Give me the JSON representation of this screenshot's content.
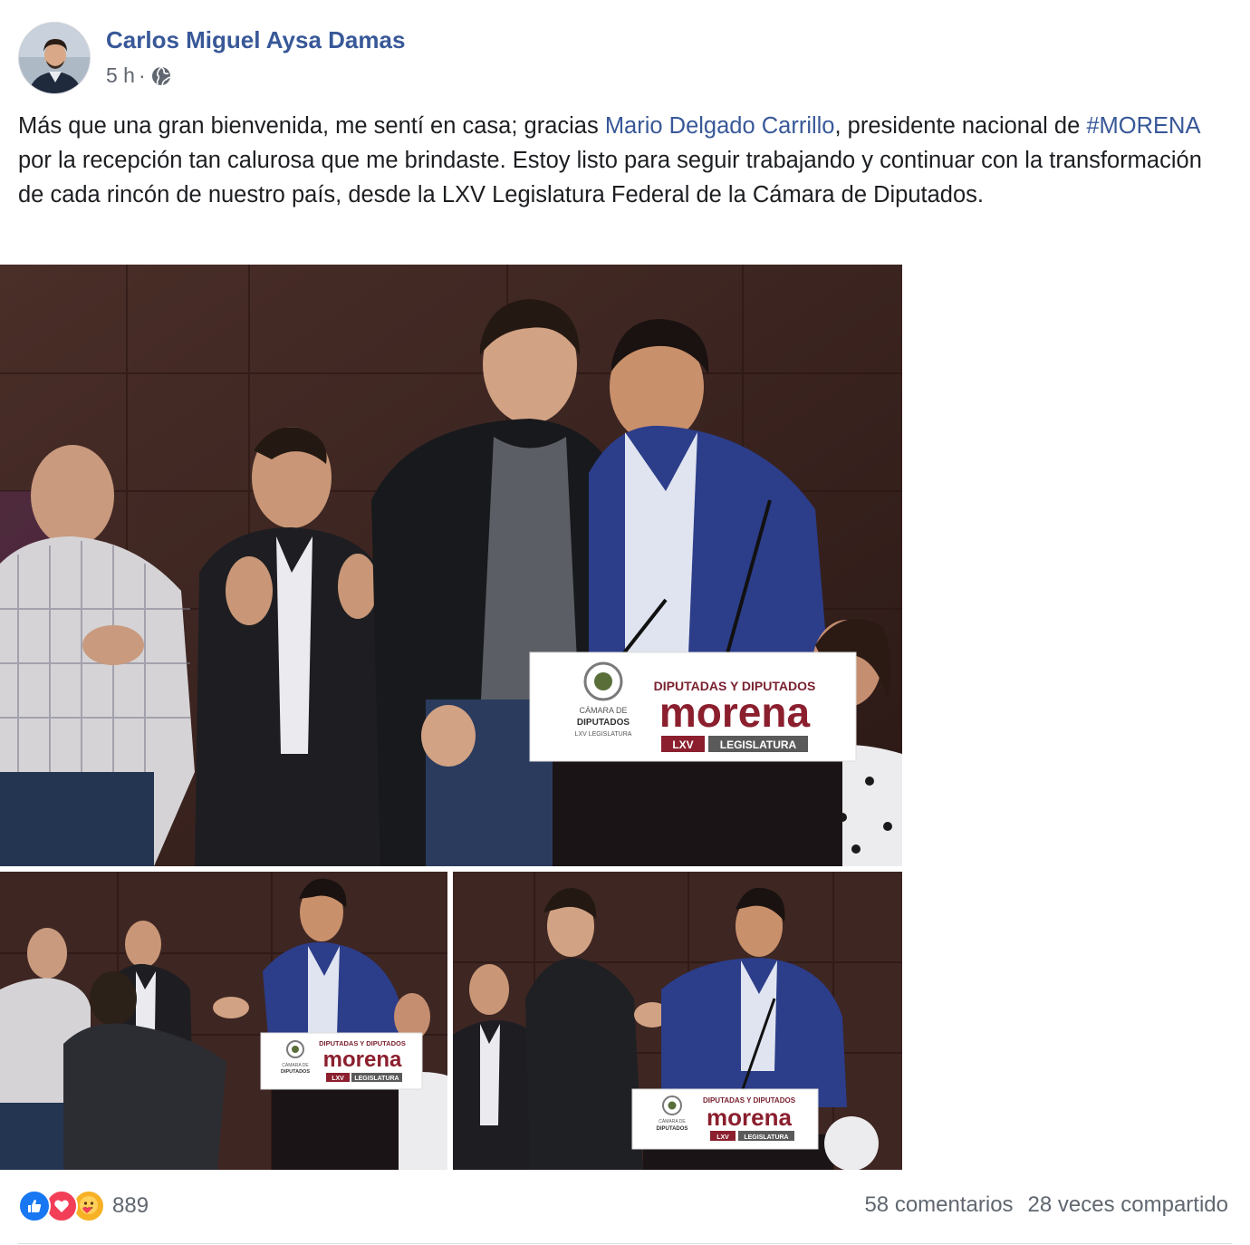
{
  "post": {
    "author_name": "Carlos Miguel Aysa Damas",
    "time": "5 h",
    "separator": "·",
    "privacy_icon": "globe-icon",
    "text": {
      "part1": "Más que una gran bienvenida, me sentí en casa; gracias ",
      "mention": "Mario Delgado Carrillo",
      "part2": ", presidente nacional de ",
      "hashtag": "#MORENA",
      "part3": " por la recepción tan calurosa que me brindaste. Estoy listo para seguir trabajando y continuar con la transformación de cada rincón de nuestro país, desde la LXV Legislatura Federal de la Cámara de Diputados."
    },
    "photos": [
      {
        "podium_line1": "DIPUTADAS Y DIPUTADOS",
        "podium_brand": "morena",
        "podium_badge1": "LXV",
        "podium_badge2": "LEGISLATURA",
        "podium_seal_line1": "CÁMARA DE",
        "podium_seal_line2": "DIPUTADOS",
        "podium_seal_line3": "LXV LEGISLATURA"
      },
      {
        "podium_line1": "DIPUTADAS Y DIPUTADOS",
        "podium_brand": "morena",
        "podium_badge1": "LXV",
        "podium_badge2": "LEGISLATURA",
        "podium_seal_line1": "CÁMARA DE",
        "podium_seal_line2": "DIPUTADOS"
      },
      {
        "podium_line1": "DIPUTADAS Y DIPUTADOS",
        "podium_brand": "morena",
        "podium_badge1": "LXV",
        "podium_badge2": "LEGISLATURA",
        "podium_seal_line1": "CÁMARA DE",
        "podium_seal_line2": "DIPUTADOS"
      }
    ],
    "reactions": {
      "icons": [
        "like-icon",
        "love-icon",
        "care-icon"
      ],
      "colors": {
        "like": "#1877f2",
        "love": "#f33e58",
        "care": "#f7b125"
      },
      "count": "889"
    },
    "comments": "58 comentarios",
    "shares": "28 veces compartido"
  },
  "colors": {
    "link": "#385898",
    "meta_text": "#606770",
    "brand_maroon": "#8b1f2e"
  }
}
